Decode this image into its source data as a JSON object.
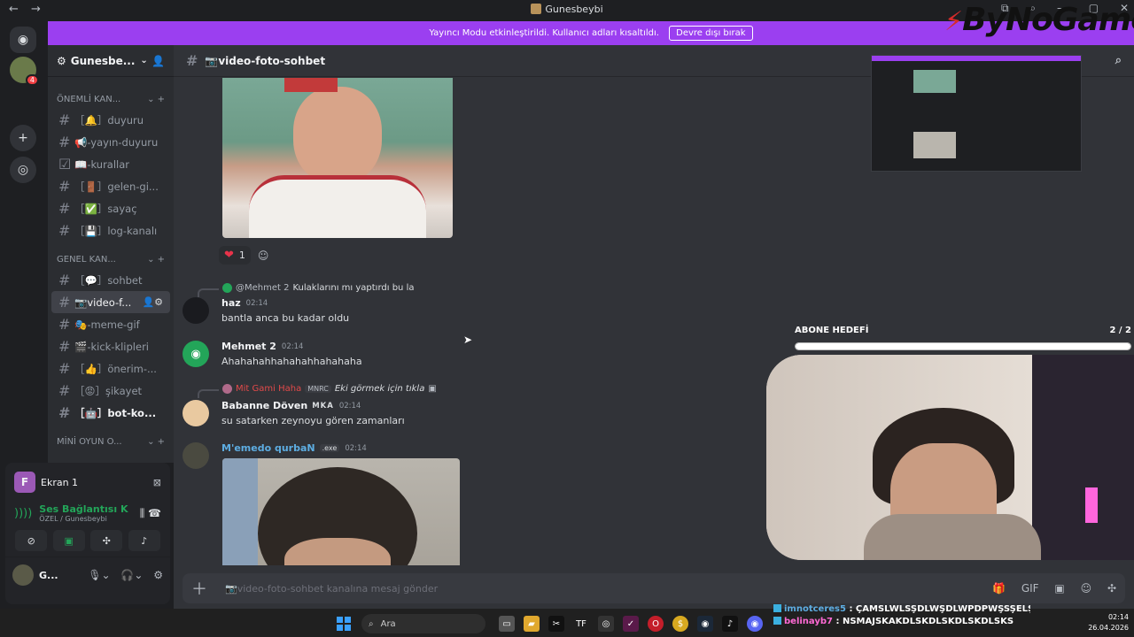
{
  "window": {
    "title": "Gunesbeybi",
    "back": "←",
    "forward": "→",
    "controls": [
      "⧉",
      "⌕",
      "—",
      "▢",
      "✕"
    ]
  },
  "banner": {
    "text": "Yayıncı Modu etkinleştirildi. Kullanıcı adları kısaltıldı.",
    "button": "Devre dışı bırak"
  },
  "overlay": {
    "logo": "ByNoGame",
    "sub_goal_label": "ABONE HEDEFİ",
    "sub_goal_count": "2 / 2",
    "sub_goal_fraction": 1.0
  },
  "guild": {
    "name": "Gunesbe...",
    "server_badge": "4"
  },
  "categories": {
    "important": "ÖNEMLİ KAN...",
    "general": "GENEL KAN...",
    "mini": "MİNİ OYUN O..."
  },
  "channels_important": [
    {
      "label": "［🔔］duyuru",
      "icon": "hash"
    },
    {
      "label": "📢-yayın-duyuru",
      "icon": "hash"
    },
    {
      "label": "📖-kurallar",
      "icon": "rules"
    },
    {
      "label": "［🚪］gelen-gi...",
      "icon": "hash"
    },
    {
      "label": "［✅］sayaç",
      "icon": "hash"
    },
    {
      "label": "［💾］log-kanalı",
      "icon": "hash"
    }
  ],
  "channels_general": [
    {
      "label": "［💬］sohbet",
      "state": ""
    },
    {
      "label": "📷video-f...",
      "state": "active"
    },
    {
      "label": "🎭-meme-gif",
      "state": ""
    },
    {
      "label": "🎬-kick-klipleri",
      "state": ""
    },
    {
      "label": "［👍］önerim-...",
      "state": ""
    },
    {
      "label": "［😡］şikayet",
      "state": ""
    },
    {
      "label": "［🤖］bot-ko...",
      "state": "bold"
    }
  ],
  "voice": {
    "stream_label": "Ekran 1",
    "stream_initial": "F",
    "connection": "Ses Bağlantısı K",
    "location": "ÖZEL / Gunesbeybi",
    "user_name": "G..."
  },
  "channel_header": {
    "name": "📷video-foto-sohbet"
  },
  "reaction": {
    "emoji": "❤",
    "count": "1"
  },
  "messages": [
    {
      "reply_user": "@Mehmet 2",
      "reply_text": "Kulaklarını mı yaptırdı bu la",
      "author": "haz",
      "time": "02:14",
      "text": "bantla anca bu kadar oldu"
    },
    {
      "author": "Mehmet 2",
      "time": "02:14",
      "text": "Ahahahahhahahahhahahaha"
    },
    {
      "reply_user": "Mit Gami Haha",
      "reply_tag": "MNRC",
      "reply_text": "Eki görmek için tıkla",
      "author": "Babanne Döven",
      "author_tag": "MKA",
      "time": "02:14",
      "text": "su satarken zeynoyu gören zamanları"
    },
    {
      "author": "M'emedo qurbaN",
      "author_tag": ".exe",
      "time": "02:14"
    }
  ],
  "composer": {
    "placeholder": "📷video-foto-sohbet kanalına mesaj gönder"
  },
  "chat_overlay": [
    {
      "user": "imnotceres5",
      "text": ": ÇAMSLWLSŞDLWŞDLWPDPWŞSŞELŞEŞDŞDŞDŞDŞDŞDŞD"
    },
    {
      "user": "belinayb7",
      "text": ": NSMAJSKAKDLSKDLSKDLSKDLSKS"
    }
  ],
  "taskbar": {
    "search": "Ara",
    "time": "02:14",
    "date": "26.04.2026"
  }
}
